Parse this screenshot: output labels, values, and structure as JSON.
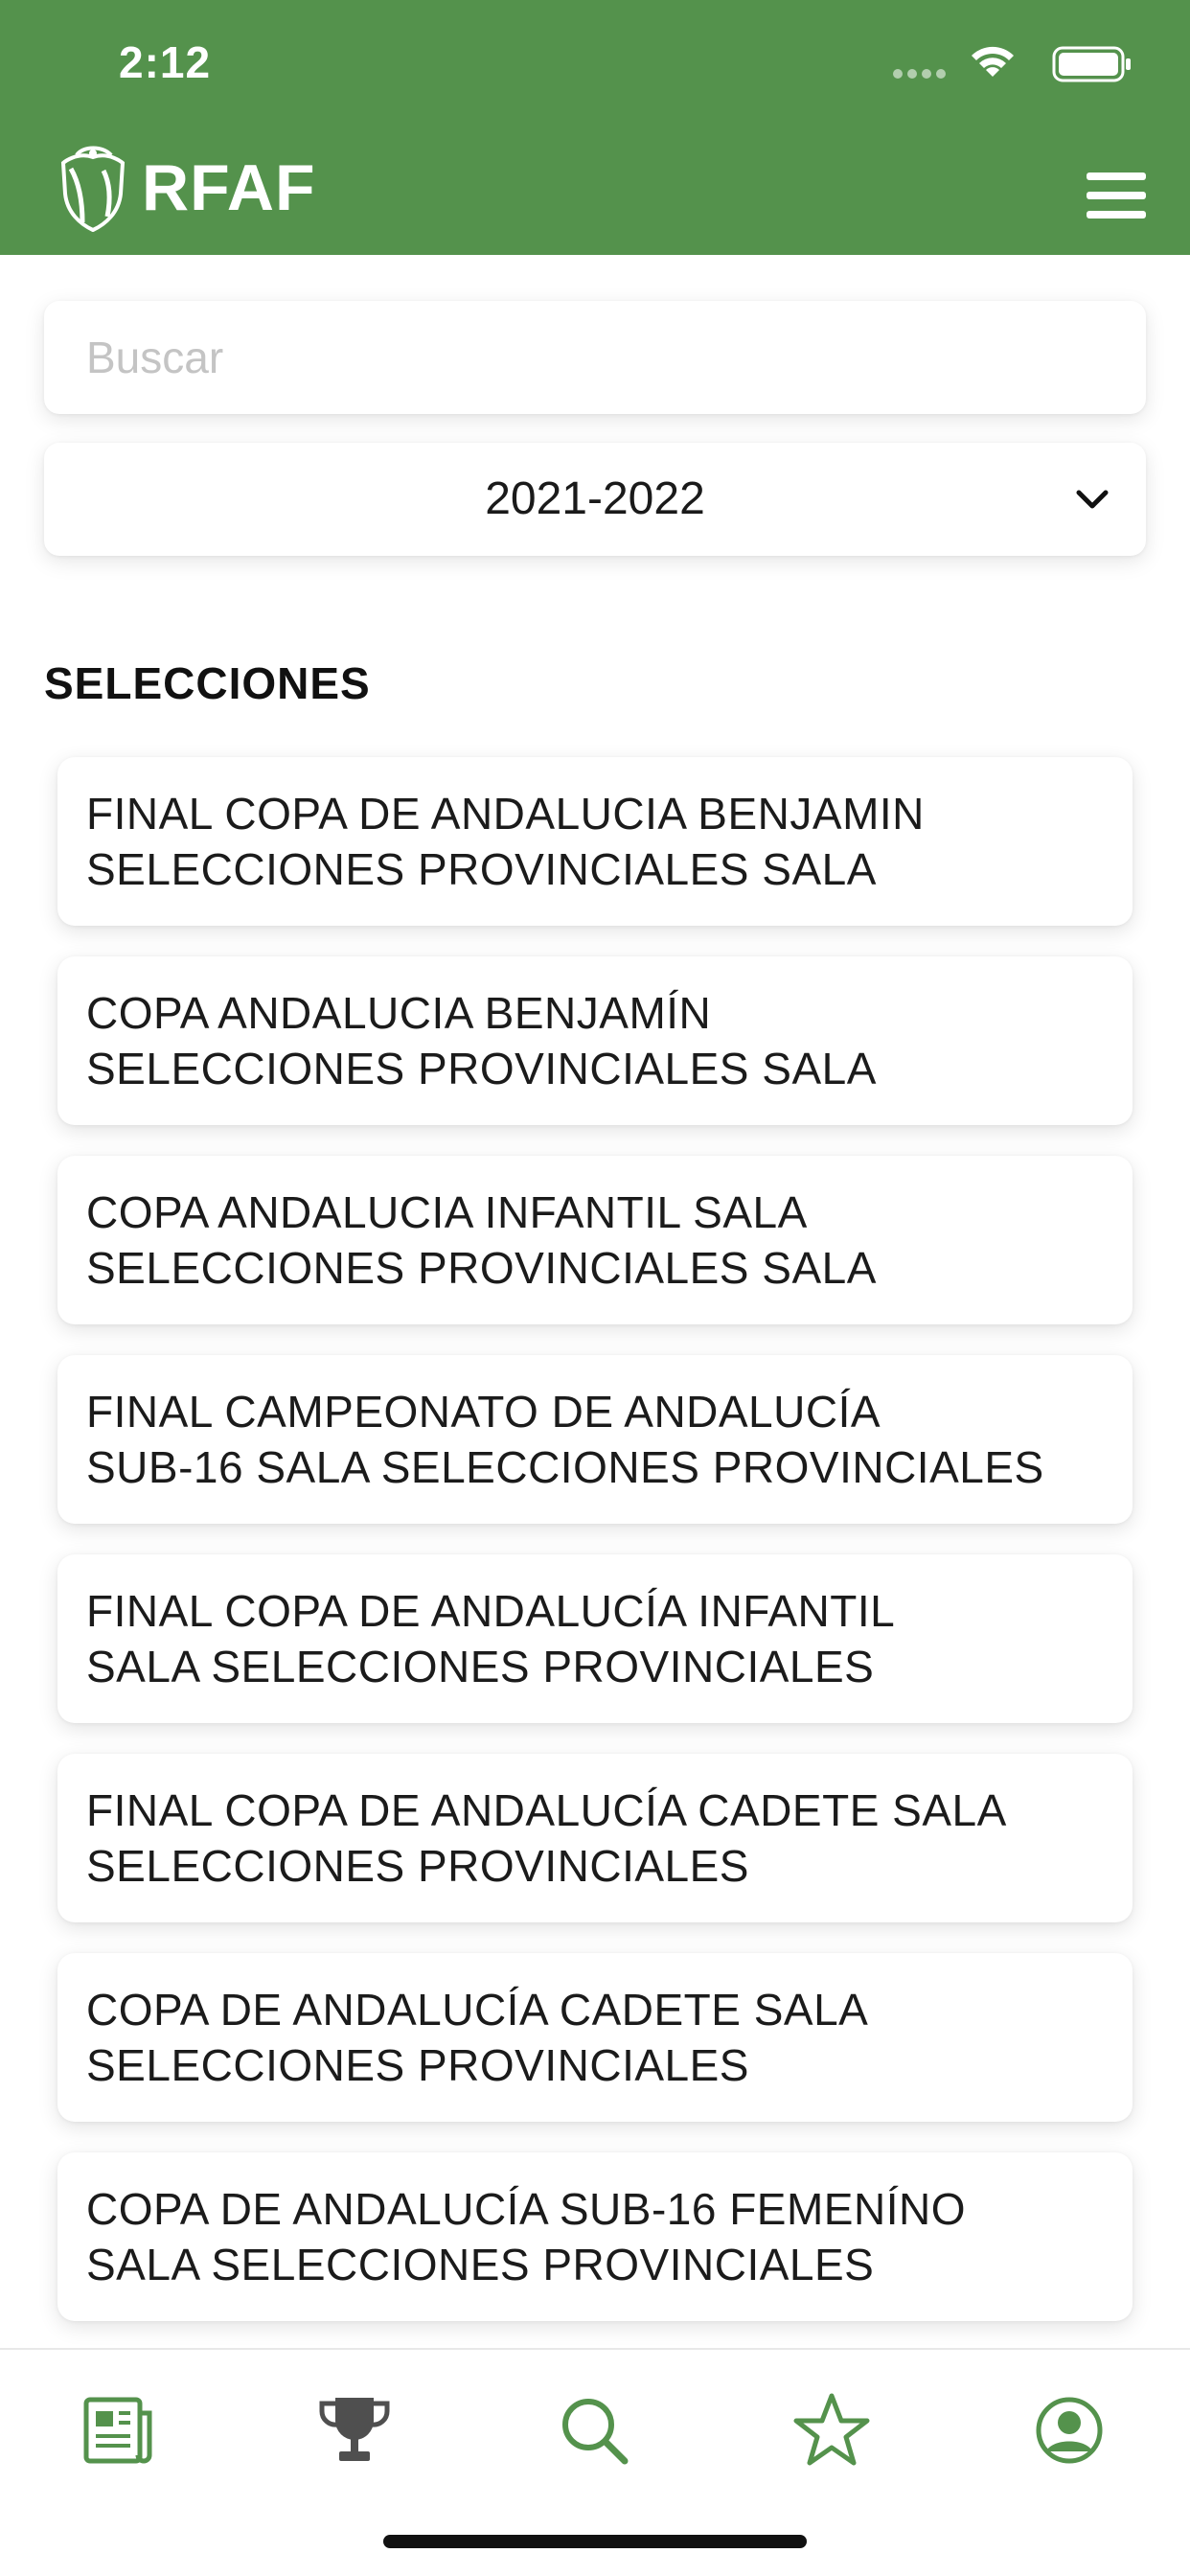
{
  "status": {
    "time": "2:12"
  },
  "header": {
    "logo_text": "RFAF"
  },
  "search": {
    "placeholder": "Buscar"
  },
  "season": {
    "selected": "2021-2022"
  },
  "section": {
    "title": "SELECCIONES"
  },
  "competitions": [
    {
      "name": "FINAL COPA DE ANDALUCIA BENJAMIN\nSELECCIONES PROVINCIALES SALA"
    },
    {
      "name": "COPA ANDALUCIA BENJAMÍN\nSELECCIONES PROVINCIALES SALA"
    },
    {
      "name": "COPA ANDALUCIA INFANTIL SALA\nSELECCIONES PROVINCIALES SALA"
    },
    {
      "name": "FINAL CAMPEONATO DE ANDALUCÍA\nSUB-16 SALA SELECCIONES PROVINCIALES"
    },
    {
      "name": "FINAL COPA DE ANDALUCÍA INFANTIL\nSALA SELECCIONES PROVINCIALES"
    },
    {
      "name": "FINAL COPA DE ANDALUCÍA CADETE SALA\nSELECCIONES PROVINCIALES"
    },
    {
      "name": "COPA DE ANDALUCÍA CADETE SALA\nSELECCIONES PROVINCIALES"
    },
    {
      "name": "COPA DE ANDALUCÍA SUB-16 FEMENÍNO\nSALA SELECCIONES PROVINCIALES"
    }
  ],
  "tabbar": {
    "tabs": [
      {
        "icon": "news-icon",
        "selected": false
      },
      {
        "icon": "trophy-icon",
        "selected": false
      },
      {
        "icon": "search-icon",
        "selected": true
      },
      {
        "icon": "star-icon",
        "selected": false
      },
      {
        "icon": "profile-icon",
        "selected": false
      }
    ]
  },
  "colors": {
    "brand_green": "#54924c",
    "tab_inactive": "#4f4f4f"
  }
}
